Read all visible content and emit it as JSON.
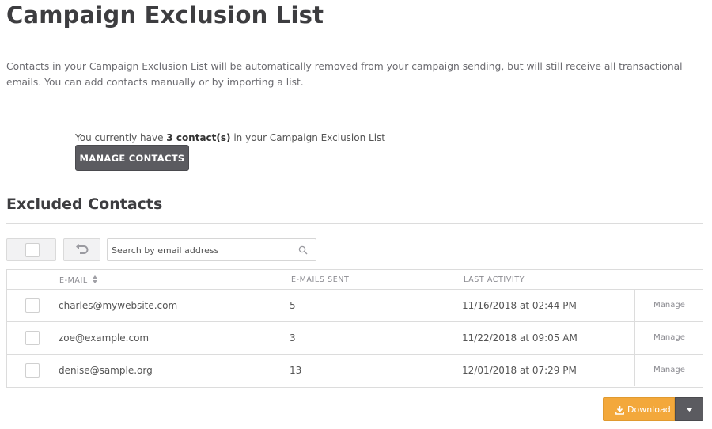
{
  "page": {
    "title": "Campaign Exclusion List",
    "intro": "Contacts in your Campaign Exclusion List will be automatically removed from your campaign sending, but will still receive all transactional emails. You can add contacts manually or by importing a list."
  },
  "summary": {
    "prefix": "You currently have ",
    "count": "3 contact(s)",
    "suffix": " in your Campaign Exclusion List",
    "manage_label": "MANAGE CONTACTS"
  },
  "section": {
    "title": "Excluded Contacts"
  },
  "toolbar": {
    "search_placeholder": "Search by email address",
    "icons": [
      "undo-icon",
      "search-icon"
    ]
  },
  "table": {
    "columns": [
      "E-MAIL",
      "E-MAILS SENT",
      "LAST ACTIVITY"
    ],
    "rows": [
      {
        "email": "charles@mywebsite.com",
        "sent": "5",
        "last_activity": "11/16/2018 at 02:44 PM",
        "action": "Manage"
      },
      {
        "email": "zoe@example.com",
        "sent": "3",
        "last_activity": "11/22/2018 at 09:05 AM",
        "action": "Manage"
      },
      {
        "email": "denise@sample.org",
        "sent": "13",
        "last_activity": "12/01/2018 at 07:29 PM",
        "action": "Manage"
      }
    ]
  },
  "footer": {
    "download_label": "Download",
    "icons": [
      "download-icon",
      "caret-down-icon"
    ]
  },
  "colors": {
    "primary_button": "#5b5b60",
    "download_button": "#f3a83b"
  }
}
